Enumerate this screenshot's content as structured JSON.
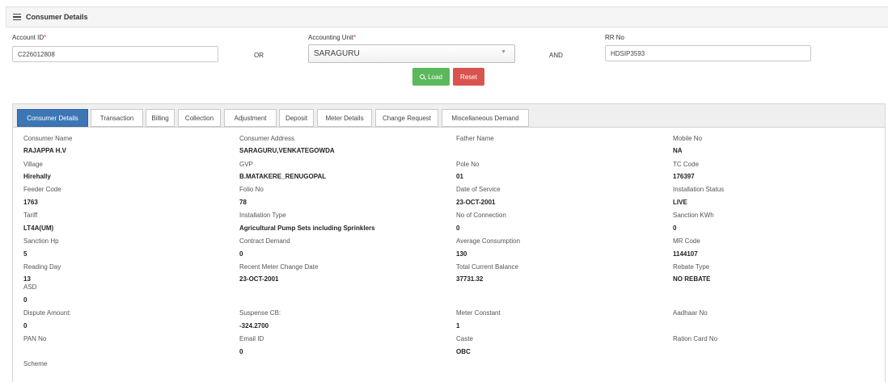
{
  "header": {
    "title": "Consumer Details",
    "icon": "hamburger-icon"
  },
  "form": {
    "account_id": {
      "label": "Account ID",
      "required_mark": "*",
      "value": "C226012808"
    },
    "or_label": "OR",
    "accounting_unit": {
      "label": "Accounting Unit",
      "required_mark": "*",
      "value": "SARAGURU"
    },
    "and_label": "AND",
    "rr_no": {
      "label": "RR No",
      "value": "HDSIP3593"
    },
    "load_label": "Load",
    "reset_label": "Reset"
  },
  "colors": {
    "active_tab": "#3c76b5",
    "load_button": "#5cb85c",
    "reset_button": "#d9534f"
  },
  "tabs": [
    {
      "label": "Consumer Details",
      "active": true
    },
    {
      "label": "Transaction"
    },
    {
      "label": "Billing"
    },
    {
      "label": "Collection"
    },
    {
      "label": "Adjustment"
    },
    {
      "label": "Deposit"
    },
    {
      "label": "Meter Details"
    },
    {
      "label": "Change Request"
    },
    {
      "label": "Miscellaneous Demand"
    }
  ],
  "details": {
    "consumer_name": {
      "label": "Consumer Name",
      "value": "RAJAPPA H.V"
    },
    "consumer_address": {
      "label": "Consumer Address",
      "value": "SARAGURU,VENKATEGOWDA"
    },
    "father_name": {
      "label": "Father Name",
      "value": ""
    },
    "mobile_no": {
      "label": "Mobile No",
      "value": "NA"
    },
    "village": {
      "label": "Village",
      "value": "Hirehally"
    },
    "gvp": {
      "label": "GVP",
      "value": "B.MATAKERE_RENUGOPAL"
    },
    "pole_no": {
      "label": "Pole No",
      "value": "01"
    },
    "tc_code": {
      "label": "TC Code",
      "value": "176397"
    },
    "feeder_code": {
      "label": "Feeder Code",
      "value": "1763"
    },
    "folio_no": {
      "label": "Folio No",
      "value": "78"
    },
    "date_of_service": {
      "label": "Date of Service",
      "value": "23-OCT-2001"
    },
    "installation_status": {
      "label": "Installation Status",
      "value": "LIVE"
    },
    "tariff": {
      "label": "Tariff",
      "value": "LT4A(UM)"
    },
    "installation_type": {
      "label": "Installation Type",
      "value": "Agricultural Pump Sets including Sprinklers"
    },
    "no_of_connection": {
      "label": "No of Connection",
      "value": "0"
    },
    "sanction_kwh": {
      "label": "Sanction KWh",
      "value": "0"
    },
    "sanction_hp": {
      "label": "Sanction Hp",
      "value": "5"
    },
    "contract_demand": {
      "label": "Contract Demand",
      "value": "0"
    },
    "average_consumption": {
      "label": "Average Consumption",
      "value": "130"
    },
    "mr_code": {
      "label": "MR Code",
      "value": "1144107"
    },
    "reading_day": {
      "label": "Reading Day",
      "value": "13"
    },
    "recent_meter_change_date": {
      "label": "Recent Meter Change Date",
      "value": "23-OCT-2001"
    },
    "total_current_balance": {
      "label": "Total Current Balance",
      "value": "37731.32"
    },
    "rebate_type": {
      "label": "Rebate Type",
      "value": "NO REBATE"
    },
    "asd": {
      "label": "ASD",
      "value": "0"
    },
    "dispute_amount": {
      "label": "Dispute Amount:",
      "value": "0"
    },
    "suspense_cb": {
      "label": "Suspense CB:",
      "value": "-324.2700"
    },
    "meter_constant": {
      "label": "Meter Constant",
      "value": "1"
    },
    "aadhaar_no": {
      "label": "Aadhaar No",
      "value": ""
    },
    "pan_no": {
      "label": "PAN No",
      "value": ""
    },
    "email_id": {
      "label": "Email ID",
      "value": "0"
    },
    "caste": {
      "label": "Caste",
      "value": "OBC"
    },
    "ration_card_no": {
      "label": "Ration Card No",
      "value": ""
    },
    "scheme": {
      "label": "Scheme",
      "value": ""
    }
  }
}
